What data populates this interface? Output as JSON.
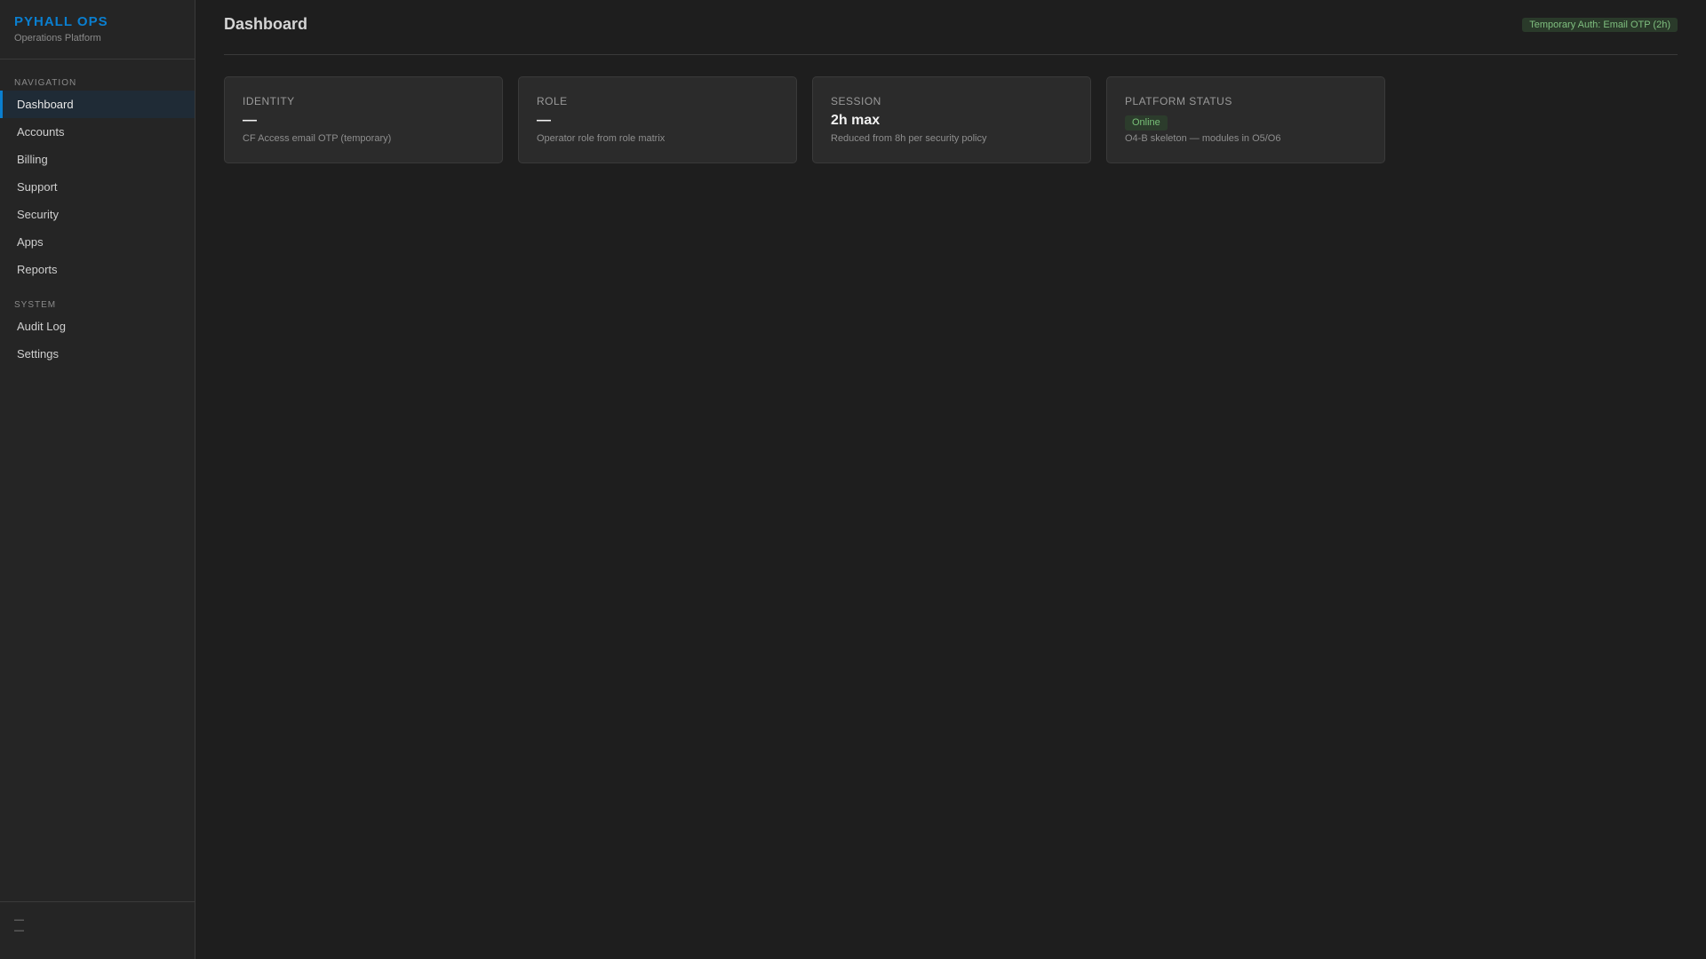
{
  "brand": {
    "name": "PYHALL OPS",
    "subtitle": "Operations Platform"
  },
  "sidebar": {
    "navigation_label": "NAVIGATION",
    "navigation": [
      {
        "label": "Dashboard",
        "active": true
      },
      {
        "label": "Accounts"
      },
      {
        "label": "Billing"
      },
      {
        "label": "Support"
      },
      {
        "label": "Security"
      },
      {
        "label": "Apps"
      },
      {
        "label": "Reports"
      }
    ],
    "system_label": "SYSTEM",
    "system": [
      {
        "label": "Audit Log"
      },
      {
        "label": "Settings"
      }
    ],
    "footer": {
      "user": "—",
      "role": "—"
    }
  },
  "header": {
    "title": "Dashboard",
    "auth_badge": "Temporary Auth: Email OTP (2h)"
  },
  "cards": [
    {
      "label": "Identity",
      "value": "—",
      "desc": "CF Access email OTP (temporary)"
    },
    {
      "label": "Role",
      "value": "—",
      "desc": "Operator role from role matrix"
    },
    {
      "label": "Session",
      "value": "2h max",
      "desc": "Reduced from 8h per security policy"
    },
    {
      "label": "Platform Status",
      "status": "Online",
      "desc": "O4-B skeleton — modules in O5/O6"
    }
  ]
}
